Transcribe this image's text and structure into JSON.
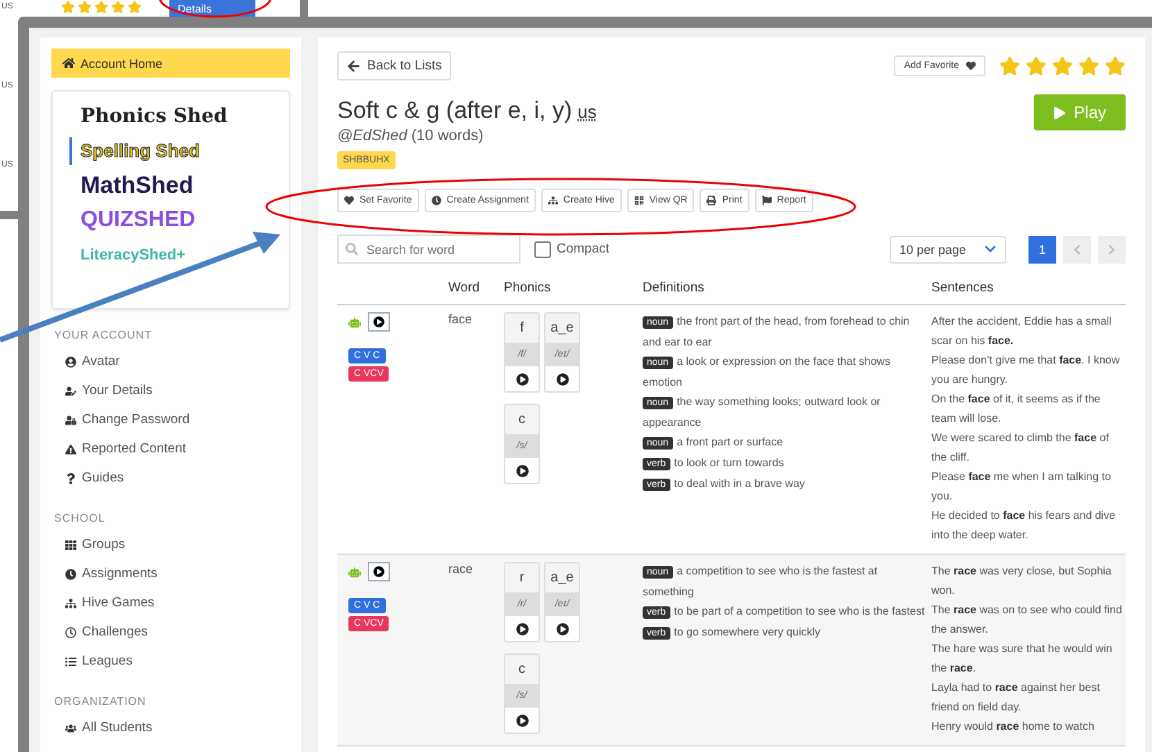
{
  "background_page": {
    "labels": [
      "US",
      "US",
      "US"
    ],
    "stars": 5,
    "details_button": "Details"
  },
  "sidebar": {
    "home_button": "Account Home",
    "logos": [
      {
        "text": "Phonics Shed",
        "kind": "phonics",
        "selected": false
      },
      {
        "text": "Spelling Shed",
        "kind": "spelling",
        "selected": true
      },
      {
        "text": "MathShed",
        "kind": "math",
        "selected": false
      },
      {
        "text": "QUIZSHED",
        "kind": "quiz",
        "selected": false
      },
      {
        "text": "LiteracyShed+",
        "kind": "literacy",
        "selected": false
      }
    ],
    "sections": [
      {
        "title": "YOUR ACCOUNT",
        "items": [
          "Avatar",
          "Your Details",
          "Change Password",
          "Reported Content",
          "Guides"
        ]
      },
      {
        "title": "SCHOOL",
        "items": [
          "Groups",
          "Assignments",
          "Hive Games",
          "Challenges",
          "Leagues"
        ]
      },
      {
        "title": "ORGANIZATION",
        "items": [
          "All Students"
        ]
      }
    ]
  },
  "header": {
    "back_button": "Back to Lists",
    "favorite_button": "Add Favorite",
    "stars": 5,
    "play_button": "Play"
  },
  "list": {
    "title": "Soft c & g (after e, i, y)",
    "locale": "us",
    "author": "*@EdShed* (10 words)",
    "code": "SHBBUHX"
  },
  "actions": [
    "Set Favorite",
    "Create Assignment",
    "Create Hive",
    "View QR",
    "Print",
    "Report"
  ],
  "toolbar": {
    "search": {
      "placeholder": "Search for word"
    },
    "compact": {
      "label": "Compact",
      "checked": false
    },
    "per_page": "10 per page",
    "pages": [
      {
        "label": "1",
        "selected": true
      }
    ]
  },
  "table": {
    "columns": [
      "Word",
      "Phonics",
      "Definitions",
      "Sentences"
    ],
    "rows": [
      {
        "word": "face",
        "badges": [
          {
            "text": "C V C",
            "color": "#2f6fde"
          },
          {
            "text": "C VCV",
            "color": "#e8365d"
          }
        ],
        "phonics": [
          {
            "grapheme": "f",
            "phoneme": "/f/"
          },
          {
            "grapheme": "a_e",
            "phoneme": "/eɪ/"
          },
          {
            "grapheme": "c",
            "phoneme": "/s/"
          }
        ],
        "definitions": [
          {
            "pos": "noun",
            "text": "the front part of the head, from forehead to chin and ear to ear"
          },
          {
            "pos": "noun",
            "text": "a look or expression on the face that shows emotion"
          },
          {
            "pos": "noun",
            "text": "the way something looks; outward look or appearance"
          },
          {
            "pos": "noun",
            "text": "a front part or surface"
          },
          {
            "pos": "verb",
            "text": "to look or turn towards"
          },
          {
            "pos": "verb",
            "text": "to deal with in a brave way"
          }
        ],
        "sentences": [
          "After the accident, Eddie has a small scar on his **face.**",
          "Please don’t give me that **face**. I know you are hungry.",
          "On the **face** of it, it seems as if the team will lose.",
          "We were scared to climb the **face** of the cliff.",
          "Please **face** me when I am talking to you.",
          "He decided to **face** his fears and dive into the deep water."
        ]
      },
      {
        "word": "race",
        "badges": [
          {
            "text": "C V C",
            "color": "#2f6fde"
          },
          {
            "text": "C VCV",
            "color": "#e8365d"
          }
        ],
        "phonics": [
          {
            "grapheme": "r",
            "phoneme": "/r/"
          },
          {
            "grapheme": "a_e",
            "phoneme": "/eɪ/"
          },
          {
            "grapheme": "c",
            "phoneme": "/s/"
          }
        ],
        "definitions": [
          {
            "pos": "noun",
            "text": "a competition to see who is the fastest at something"
          },
          {
            "pos": "verb",
            "text": "to be part of a competition to see who is the fastest"
          },
          {
            "pos": "verb",
            "text": "to go somewhere very quickly"
          }
        ],
        "sentences": [
          "The **race** was very close, but Sophia won.",
          "The **race** was on to see who could find the answer.",
          "The hare was sure that he would win the **race**.",
          "Layla had to **race** against her best friend on field day.",
          "Henry would **race** home to watch"
        ]
      }
    ]
  }
}
